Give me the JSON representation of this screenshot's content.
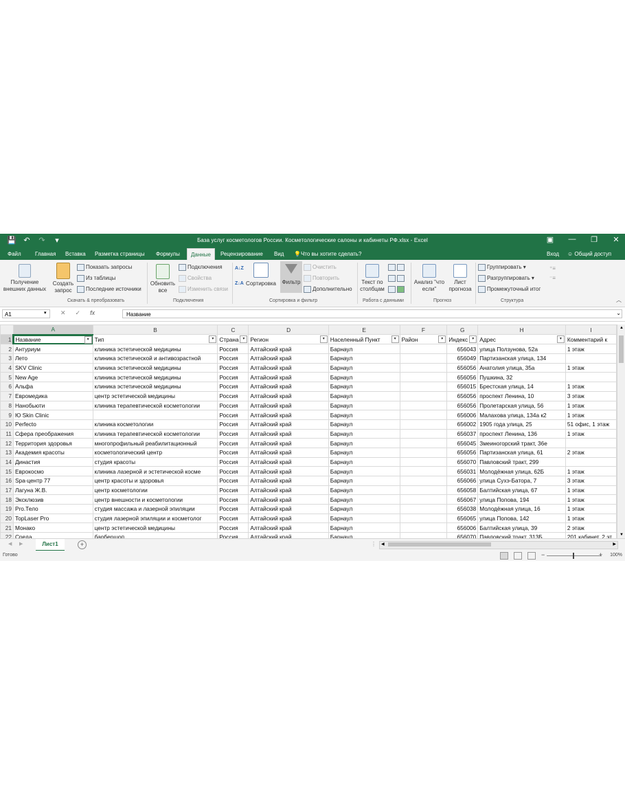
{
  "window": {
    "title": "База услуг косметологов России. Косметологические салоны и кабинеты РФ.xlsx - Excel",
    "accent_color": "#217346"
  },
  "tabs": [
    "Файл",
    "Главная",
    "Вставка",
    "Разметка страницы",
    "Формулы",
    "Данные",
    "Рецензирование",
    "Вид"
  ],
  "tell_me": "Что вы хотите сделать?",
  "sign_in": "Вход",
  "share": "Общий доступ",
  "ribbon": {
    "get_external_line1": "Получение",
    "get_external_line2": "внешних данных",
    "create_query_line1": "Создать",
    "create_query_line2": "запрос",
    "show_queries": "Показать запросы",
    "from_table": "Из таблицы",
    "recent_sources": "Последние источники",
    "refresh_line1": "Обновить",
    "refresh_line2": "все",
    "connections": "Подключения",
    "properties": "Свойства",
    "edit_links": "Изменить связи",
    "sort": "Сортировка",
    "filter": "Фильтр",
    "clear": "Очистить",
    "reapply": "Повторить",
    "advanced": "Дополнительно",
    "text_to_columns_line1": "Текст по",
    "text_to_columns_line2": "столбцам",
    "what_if_line1": "Анализ \"что",
    "what_if_line2": "если\"",
    "forecast_line1": "Лист",
    "forecast_line2": "прогноза",
    "group": "Группировать",
    "ungroup": "Разгруппировать",
    "subtotal": "Промежуточный итог",
    "groups": [
      "Скачать & преобразовать",
      "Подключения",
      "Сортировка и фильтр",
      "Работа с данными",
      "Прогноз",
      "Структура"
    ]
  },
  "formula_bar": {
    "name_box": "A1",
    "fx": "fx",
    "content": "Название"
  },
  "columns": [
    "A",
    "B",
    "C",
    "D",
    "E",
    "F",
    "G",
    "H",
    "I"
  ],
  "headers": [
    "Название",
    "Тип",
    "Страна",
    "Регион",
    "Населенный Пункт",
    "Район",
    "Индекс",
    "Адрес",
    "Комментарий к"
  ],
  "rows": [
    [
      "Антуриум",
      "клиника эстетической медицины",
      "Россия",
      "Алтайский край",
      "Барнаул",
      "",
      "656043",
      "улица Ползунова, 52а",
      "1 этаж"
    ],
    [
      "Лето",
      "клиника эстетической и антивозрастной",
      "Россия",
      "Алтайский край",
      "Барнаул",
      "",
      "656049",
      "Партизанская улица, 134",
      ""
    ],
    [
      "SKV Clinic",
      "клиника эстетической медицины",
      "Россия",
      "Алтайский край",
      "Барнаул",
      "",
      "656056",
      "Анатолия улица, 35а",
      "1 этаж"
    ],
    [
      "New Age",
      "клиника эстетической медицины",
      "Россия",
      "Алтайский край",
      "Барнаул",
      "",
      "656056",
      "Пушкина, 32",
      ""
    ],
    [
      "Альфа",
      "клиника эстетической медицины",
      "Россия",
      "Алтайский край",
      "Барнаул",
      "",
      "656015",
      "Брестская улица, 14",
      "1 этаж"
    ],
    [
      "Евромедика",
      "центр эстетической медицины",
      "Россия",
      "Алтайский край",
      "Барнаул",
      "",
      "656056",
      "проспект Ленина, 10",
      "3 этаж"
    ],
    [
      "Нанобьюти",
      "клиника терапевтической косметологии",
      "Россия",
      "Алтайский край",
      "Барнаул",
      "",
      "656056",
      "Пролетарская улица, 56",
      "1 этаж"
    ],
    [
      "Ю Skin Clinic",
      "",
      "Россия",
      "Алтайский край",
      "Барнаул",
      "",
      "656006",
      "Малахова улица, 134а к2",
      "1 этаж"
    ],
    [
      "Perfecto",
      "клиника косметологии",
      "Россия",
      "Алтайский край",
      "Барнаул",
      "",
      "656002",
      "1905 года улица, 25",
      "51 офис, 1 этаж"
    ],
    [
      "Сфера преображения",
      "клиника терапевтической косметологии",
      "Россия",
      "Алтайский край",
      "Барнаул",
      "",
      "656037",
      "проспект Ленина, 136",
      "1 этаж"
    ],
    [
      "Территория здоровья",
      "многопрофильный реабилитационный",
      "Россия",
      "Алтайский край",
      "Барнаул",
      "",
      "656045",
      "Змеиногорский тракт, 36е",
      ""
    ],
    [
      "Академия красоты",
      "косметологический центр",
      "Россия",
      "Алтайский край",
      "Барнаул",
      "",
      "656056",
      "Партизанская улица, 61",
      "2 этаж"
    ],
    [
      "Династия",
      "студия красоты",
      "Россия",
      "Алтайский край",
      "Барнаул",
      "",
      "656070",
      "Павловский тракт, 299",
      ""
    ],
    [
      "Еврокосмо",
      "клиника лазерной и эстетической косме",
      "Россия",
      "Алтайский край",
      "Барнаул",
      "",
      "656031",
      "Молодёжная улица, 62Б",
      "1 этаж"
    ],
    [
      "Spa-центр 77",
      "центр красоты и здоровья",
      "Россия",
      "Алтайский край",
      "Барнаул",
      "",
      "656066",
      "улица Сухэ-Батора, 7",
      "3 этаж"
    ],
    [
      "Лагуна Ж.В.",
      "центр косметологии",
      "Россия",
      "Алтайский край",
      "Барнаул",
      "",
      "656058",
      "Балтийская улица, 67",
      "1 этаж"
    ],
    [
      "Эксклюзив",
      "центр внешности и косметологии",
      "Россия",
      "Алтайский край",
      "Барнаул",
      "",
      "656067",
      "улица Попова, 194",
      "1 этаж"
    ],
    [
      "Pro.Тело",
      "студия массажа и лазерной эпиляции",
      "Россия",
      "Алтайский край",
      "Барнаул",
      "",
      "656038",
      "Молодёжная улица, 16",
      "1 этаж"
    ],
    [
      "TopLaser Pro",
      "студия лазерной эпиляции и косметолог",
      "Россия",
      "Алтайский край",
      "Барнаул",
      "",
      "656065",
      "улица Попова, 142",
      "1 этаж"
    ],
    [
      "Монако",
      "центр эстетической медицины",
      "Россия",
      "Алтайский край",
      "Барнаул",
      "",
      "656006",
      "Балтийская улица, 39",
      "2 этаж"
    ],
    [
      "Среда",
      "барбершоп",
      "Россия",
      "Алтайский край",
      "Барнаул",
      "",
      "656070",
      "Павловский тракт, 313Б",
      "201 кабинет, 2 эт"
    ]
  ],
  "sheet_tab": "Лист1",
  "status": {
    "ready": "Готово",
    "zoom": "100%"
  }
}
